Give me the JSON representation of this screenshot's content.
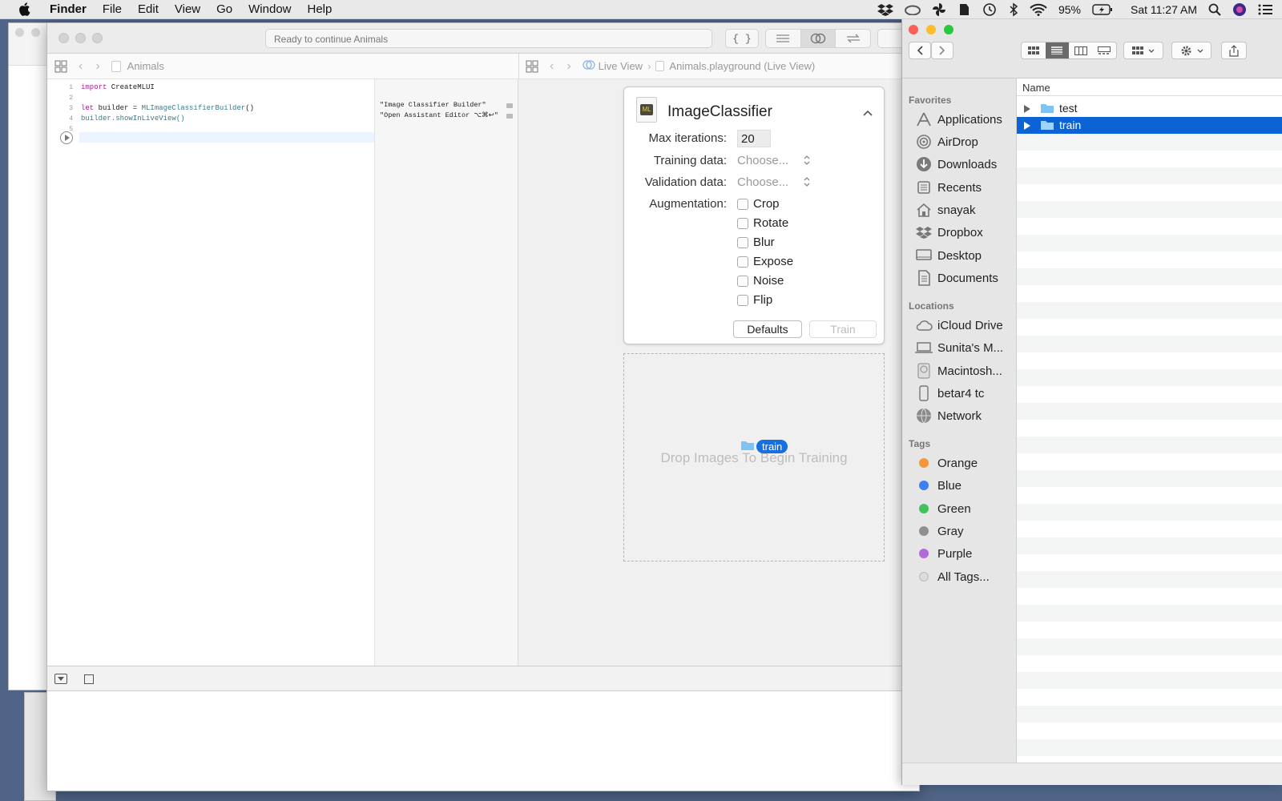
{
  "menubar": {
    "app_name": "Finder",
    "items": [
      "File",
      "Edit",
      "View",
      "Go",
      "Window",
      "Help"
    ],
    "battery": "95%",
    "clock": "Sat 11:27 AM"
  },
  "xcode": {
    "status": "Ready to continue Animals",
    "editor_breadcrumb": "Animals",
    "live_breadcrumb": [
      "Live View",
      "Animals.playground (Live View)"
    ],
    "line_numbers": [
      "1",
      "2",
      "3",
      "4",
      "5"
    ],
    "code": {
      "l1_kw": "import",
      "l1_rest": " CreateMLUI",
      "l3_kw": "let",
      "l3_mid": " builder = ",
      "l3_type": "MLImageClassifierBuilder",
      "l3_end": "()",
      "l4": "builder.showInLiveView()"
    },
    "results": [
      "\"Image Classifier Builder\"",
      "\"Open Assistant Editor ⌥⌘↩\""
    ]
  },
  "panel": {
    "title": "ImageClassifier",
    "max_iterations_label": "Max iterations:",
    "max_iterations_value": "20",
    "training_label": "Training data:",
    "training_value": "Choose...",
    "validation_label": "Validation data:",
    "validation_value": "Choose...",
    "augmentation_label": "Augmentation:",
    "options": [
      "Crop",
      "Rotate",
      "Blur",
      "Expose",
      "Noise",
      "Flip"
    ],
    "defaults_button": "Defaults",
    "train_button": "Train"
  },
  "dropzone": {
    "hint": "Drop Images To Begin Training",
    "drag_label": "train"
  },
  "finder": {
    "column_header": "Name",
    "favorites_header": "Favorites",
    "favorites": [
      "Applications",
      "AirDrop",
      "Downloads",
      "Recents",
      "snayak",
      "Dropbox",
      "Desktop",
      "Documents"
    ],
    "locations_header": "Locations",
    "locations": [
      "iCloud Drive",
      "Sunita's M...",
      "Macintosh...",
      "betar4 tc",
      "Network"
    ],
    "tags_header": "Tags",
    "tags": [
      {
        "name": "Orange",
        "color": "#f5963a"
      },
      {
        "name": "Blue",
        "color": "#3b82f0"
      },
      {
        "name": "Green",
        "color": "#43c15a"
      },
      {
        "name": "Gray",
        "color": "#8f8f8f"
      },
      {
        "name": "Purple",
        "color": "#b36ad9"
      },
      {
        "name": "All Tags...",
        "color": "#dcdcdc"
      }
    ],
    "files": [
      {
        "name": "test",
        "selected": false
      },
      {
        "name": "train",
        "selected": true
      }
    ]
  }
}
